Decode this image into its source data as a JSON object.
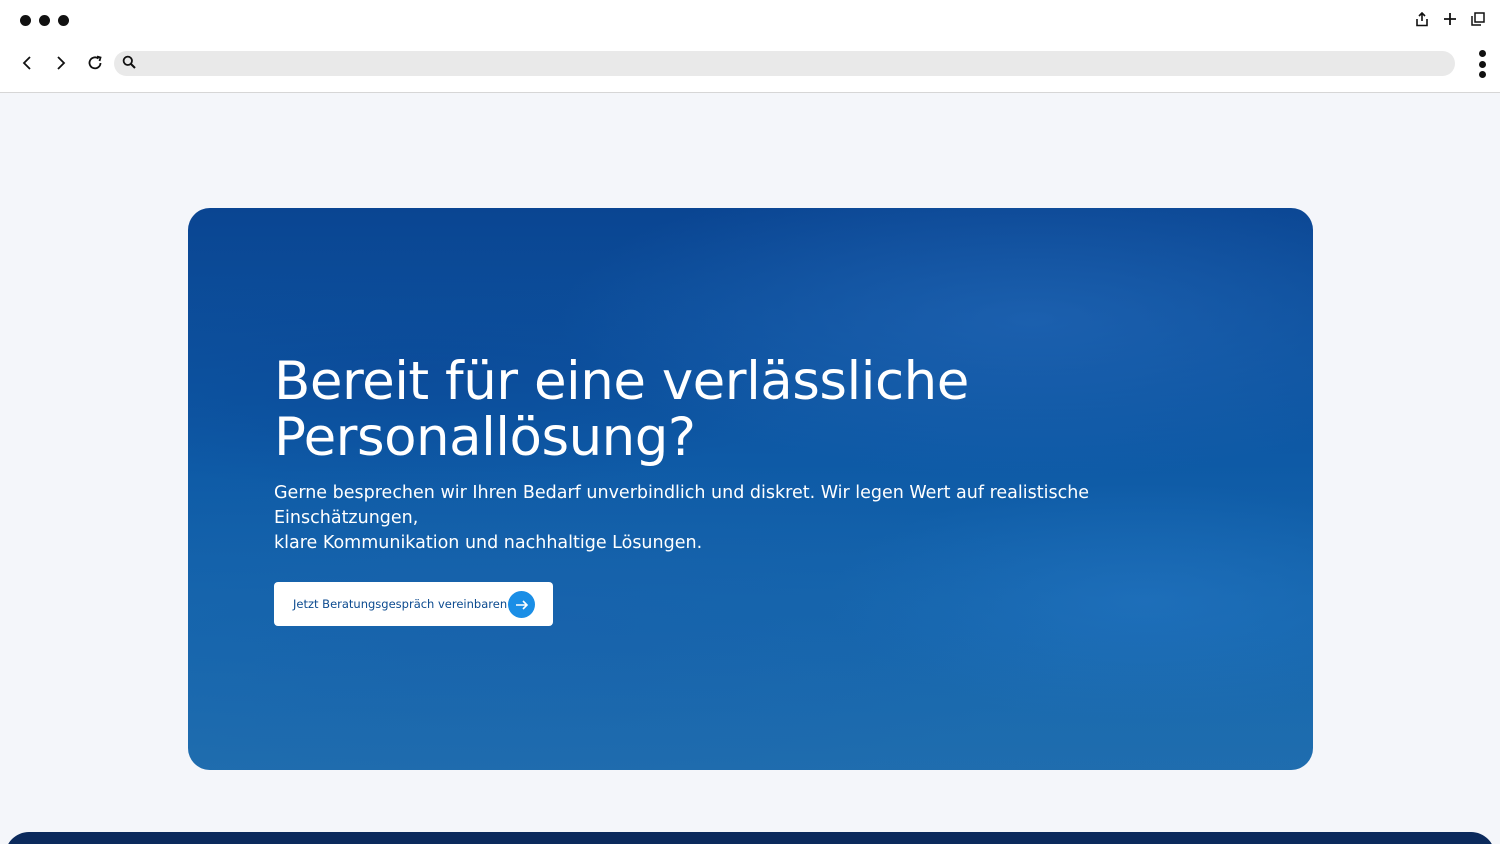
{
  "browser": {
    "address_text": ""
  },
  "hero": {
    "title_line1": "Bereit für eine verlässliche",
    "title_line2": "Personallösung?",
    "subtitle_line1": "Gerne besprechen wir Ihren Bedarf unverbindlich und diskret. Wir legen Wert auf realistische Einschätzungen,",
    "subtitle_line2": "klare Kommunikation und nachhaltige Lösungen.",
    "cta_label": "Jetzt Beratungsgespräch vereinbaren",
    "cta_icon": "arrow-right-icon"
  },
  "colors": {
    "hero_bg": "#0e5aa6",
    "cta_text": "#0b4a8f",
    "cta_icon_bg": "#1a8ee6",
    "page_bg": "#f4f6fa"
  }
}
